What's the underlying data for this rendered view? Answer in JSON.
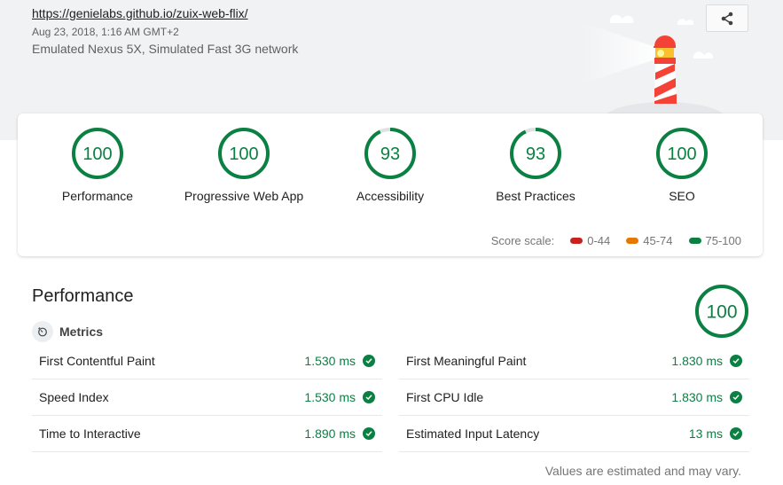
{
  "header": {
    "url": "https://genielabs.github.io/zuix-web-flix/",
    "timestamp": "Aug 23, 2018, 1:16 AM GMT+2",
    "environment": "Emulated Nexus 5X, Simulated Fast 3G network",
    "share_icon": "share-icon"
  },
  "colors": {
    "pass": "#0b8043",
    "average": "#e67700",
    "fail": "#c7221f",
    "track": "#e0e0e0"
  },
  "gauges": [
    {
      "label": "Performance",
      "score": "100",
      "value": 100
    },
    {
      "label": "Progressive Web App",
      "score": "100",
      "value": 100
    },
    {
      "label": "Accessibility",
      "score": "93",
      "value": 93
    },
    {
      "label": "Best Practices",
      "score": "93",
      "value": 93
    },
    {
      "label": "SEO",
      "score": "100",
      "value": 100
    }
  ],
  "score_scale": {
    "label": "Score scale:",
    "ranges": [
      {
        "label": "0-44",
        "color": "#c7221f"
      },
      {
        "label": "45-74",
        "color": "#e67700"
      },
      {
        "label": "75-100",
        "color": "#0b8043"
      }
    ]
  },
  "performance": {
    "title": "Performance",
    "score": "100",
    "value": 100,
    "metrics_label": "Metrics",
    "metrics_icon": "stopwatch-icon",
    "left": [
      {
        "name": "First Contentful Paint",
        "value": "1.530 ms"
      },
      {
        "name": "Speed Index",
        "value": "1.530 ms"
      },
      {
        "name": "Time to Interactive",
        "value": "1.890 ms"
      }
    ],
    "right": [
      {
        "name": "First Meaningful Paint",
        "value": "1.830 ms"
      },
      {
        "name": "First CPU Idle",
        "value": "1.830 ms"
      },
      {
        "name": "Estimated Input Latency",
        "value": "13 ms"
      }
    ],
    "footnote": "Values are estimated and may vary."
  }
}
